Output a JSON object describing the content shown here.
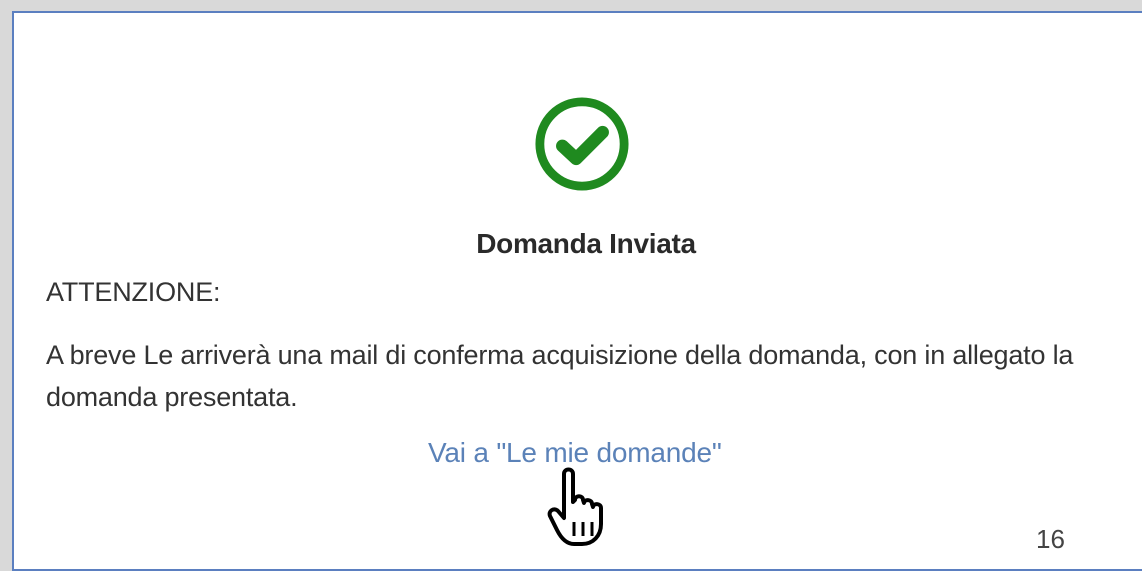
{
  "dialog": {
    "status_icon": "check-circle-icon",
    "status_color": "#1f8a1f",
    "title": "Domanda Inviata",
    "attention_label": "ATTENZIONE:",
    "message": "A breve Le arriverà una mail di conferma acquisizione della domanda, con in allegato la domanda presentata.",
    "link_label": "Vai a \"Le mie domande\"",
    "link_color": "#5b82b8"
  },
  "cursor": {
    "icon": "hand-pointer-icon"
  },
  "footer": {
    "page_number": "16"
  }
}
